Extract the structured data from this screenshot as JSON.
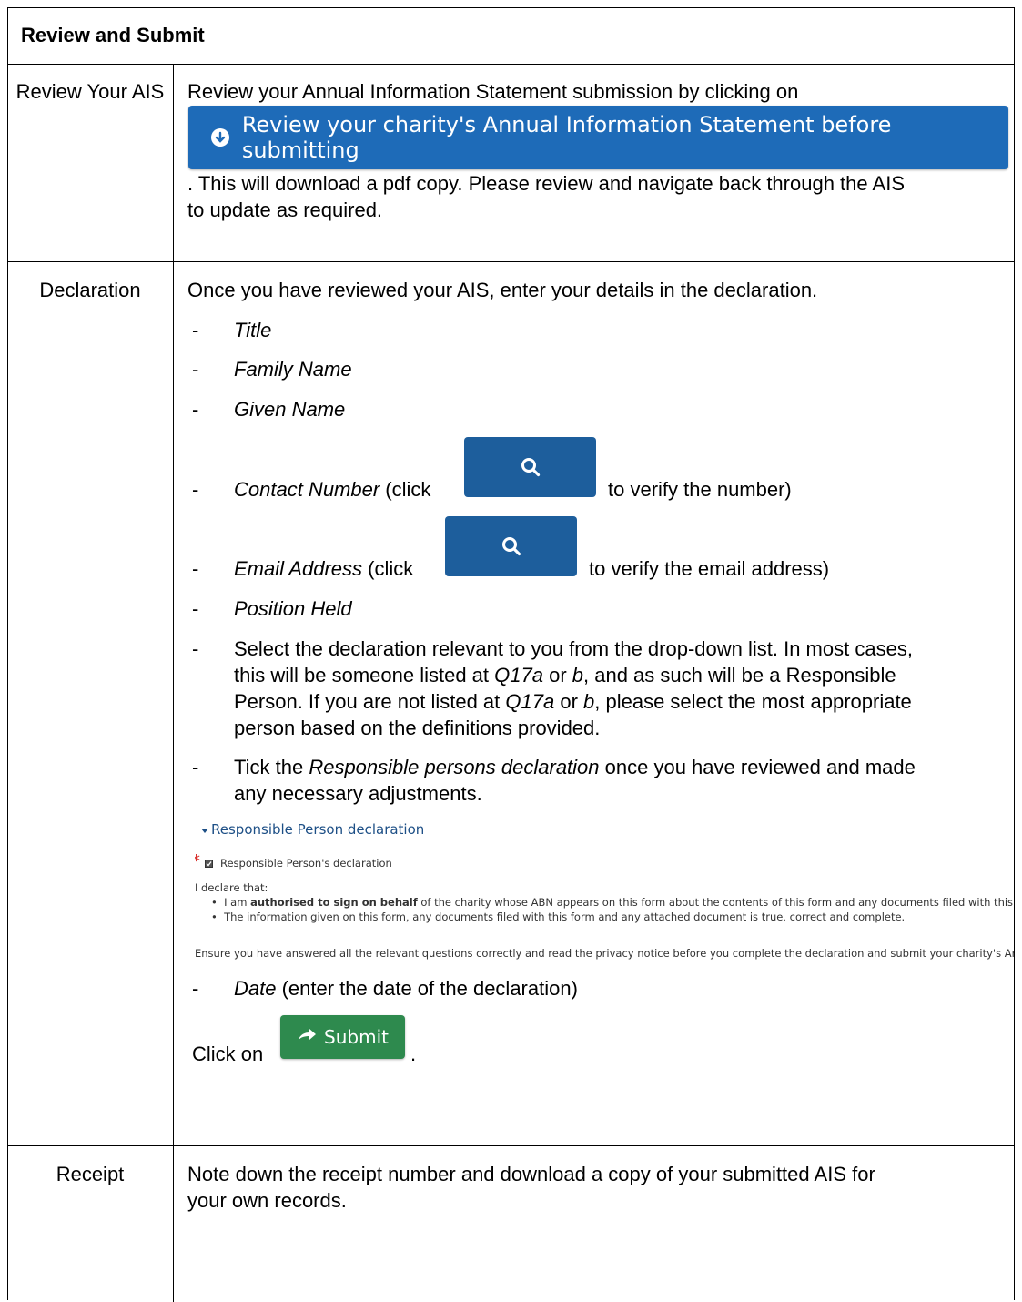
{
  "header": {
    "title": "Review and Submit"
  },
  "review": {
    "label": "Review Your AIS",
    "intro": "Review your Annual Information Statement submission by clicking on",
    "button_label": "Review your charity's Annual Information Statement before submitting",
    "after_line1": ". This will download a pdf copy. Please review and navigate back through the AIS",
    "after_line2": "to update as required."
  },
  "declaration": {
    "label": "Declaration",
    "intro": "Once you have reviewed your AIS, enter your details in the declaration.",
    "dash": "-",
    "title_field": "Title",
    "family_name": "Family Name",
    "given_name": "Given Name",
    "contact_number": "Contact Number",
    "contact_click": " (click",
    "contact_suffix": "to verify the number)",
    "email_address": "Email Address",
    "email_click": " (click",
    "email_suffix": "to verify the email address)",
    "position_held": "Position Held",
    "select_line1": "Select the declaration relevant to you from the drop-down list. In most cases,",
    "select_line2_a": "this will be someone listed at ",
    "q17a": "Q17a",
    "or": " or ",
    "b": "b",
    "select_line2_b": ", and as such will be a Responsible",
    "select_line3_a": "Person. If you are not listed at ",
    "select_line3_b": ", please select the most appropriate",
    "select_line4": "person based on the definitions provided.",
    "tick_a": "Tick the ",
    "tick_italic": "Responsible persons declaration",
    "tick_b": " once you have reviewed and made",
    "tick_line2": "any necessary adjustments.",
    "date_field": "Date",
    "date_suffix": " (enter the date of the declaration)",
    "click_on": "Click on",
    "period": "."
  },
  "panel": {
    "title": "Responsible Person declaration",
    "asterisk": "*",
    "checkbox_label": "Responsible Person's declaration",
    "i_declare": "I declare that:",
    "bullet1_a": "I am ",
    "bullet1_bold": "authorised to sign on behalf",
    "bullet1_b": " of the charity whose ABN appears on this form about the contents of this form and any documents filed with this form; a",
    "bullet2": "The information given on this form, any documents filed with this form and any attached document is true, correct and complete.",
    "ensure": "Ensure you have answered all the relevant questions correctly and read the privacy notice before you complete the declaration and submit your charity's Annua"
  },
  "submit_button": {
    "label": "Submit"
  },
  "receipt": {
    "label": "Receipt",
    "line1": "Note down the receipt number and download a copy of your submitted AIS for",
    "line2": "your own records."
  },
  "icons": [
    "arrow-down-circle-icon",
    "search-icon",
    "checkbox-icon",
    "reply-arrow-icon",
    "caret-down-icon"
  ]
}
